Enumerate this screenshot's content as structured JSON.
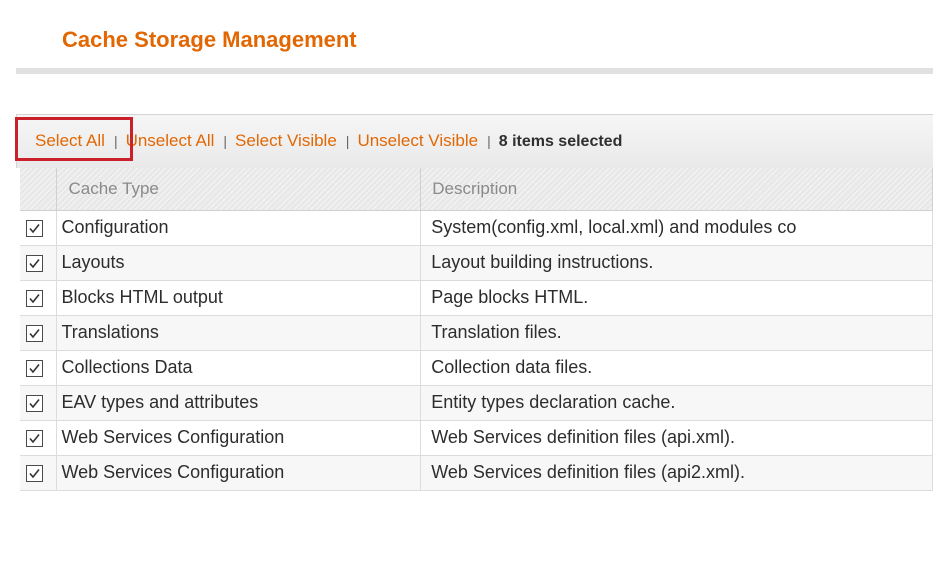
{
  "page": {
    "title": "Cache Storage Management"
  },
  "massaction": {
    "select_all": "Select All",
    "unselect_all": "Unselect All",
    "select_visible": "Select Visible",
    "unselect_visible": "Unselect Visible",
    "separator": "|",
    "items_selected": "8 items selected"
  },
  "grid": {
    "columns": [
      "Cache Type",
      "Description"
    ],
    "rows": [
      {
        "checked": true,
        "cache_type": "Configuration",
        "description": "System(config.xml, local.xml) and modules co"
      },
      {
        "checked": true,
        "cache_type": "Layouts",
        "description": "Layout building instructions."
      },
      {
        "checked": true,
        "cache_type": "Blocks HTML output",
        "description": "Page blocks HTML."
      },
      {
        "checked": true,
        "cache_type": "Translations",
        "description": "Translation files."
      },
      {
        "checked": true,
        "cache_type": "Collections Data",
        "description": "Collection data files."
      },
      {
        "checked": true,
        "cache_type": "EAV types and attributes",
        "description": "Entity types declaration cache."
      },
      {
        "checked": true,
        "cache_type": "Web Services Configuration",
        "description": "Web Services definition files (api.xml)."
      },
      {
        "checked": true,
        "cache_type": "Web Services Configuration",
        "description": "Web Services definition files (api2.xml)."
      }
    ]
  },
  "colors": {
    "accent": "#e26703",
    "highlight": "#c9202a"
  },
  "icons": {
    "checkbox_checked": "checkbox-checked-icon"
  }
}
